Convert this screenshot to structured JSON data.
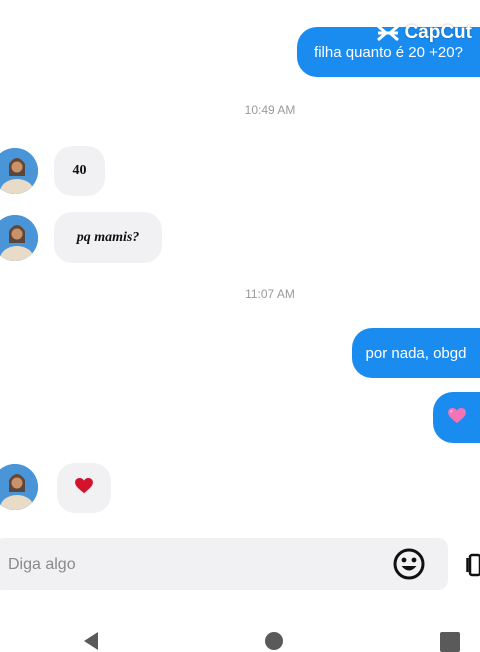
{
  "watermark": {
    "text": "CapCut"
  },
  "messages": {
    "outgoing_1": "filha quanto é 20 +20?",
    "timestamp_1": "10:49 AM",
    "incoming_1": "40",
    "incoming_2": "pq mamis?",
    "timestamp_2": "11:07 AM",
    "outgoing_2": "por nada, obgd",
    "outgoing_3_icon": "pink-heart-emoji",
    "incoming_3_icon": "red-heart-emoji"
  },
  "composer": {
    "placeholder": "Diga algo",
    "emoji_icon": "smiley-icon",
    "gallery_icon": "gallery-icon"
  },
  "navbar": {
    "icons": [
      "back-icon",
      "home-icon",
      "recent-apps-icon"
    ]
  },
  "colors": {
    "outgoing_bubble": "#1a8cf0",
    "incoming_bubble": "#f1f1f3",
    "timestamp_text": "#9a9a9a"
  }
}
